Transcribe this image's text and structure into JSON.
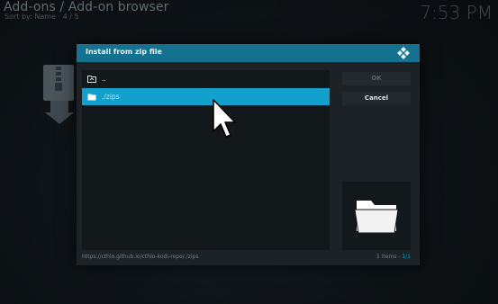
{
  "background": {
    "title": "Add-ons / Add-on browser",
    "subtitle": "Sort by: Name  ·  4 / 5",
    "time": "7:53 PM",
    "addon_icon": "zip-install-icon"
  },
  "dialog": {
    "title": "Install from zip file",
    "logo_icon": "kodi-logo-icon",
    "items": [
      {
        "label": "..",
        "icon": "parent-folder-icon",
        "selected": false
      },
      {
        "label": "./zips",
        "icon": "folder-icon",
        "selected": true
      }
    ],
    "buttons": {
      "ok": "OK",
      "cancel": "Cancel"
    },
    "thumbnail_icon": "folder-icon",
    "path": "https://cthlo.github.io/cthlo-kodi-repo/./zips",
    "count_label": "1 items - ",
    "count_value": "1/1"
  },
  "colors": {
    "header": "#14718f",
    "selected": "#12a0cc"
  }
}
